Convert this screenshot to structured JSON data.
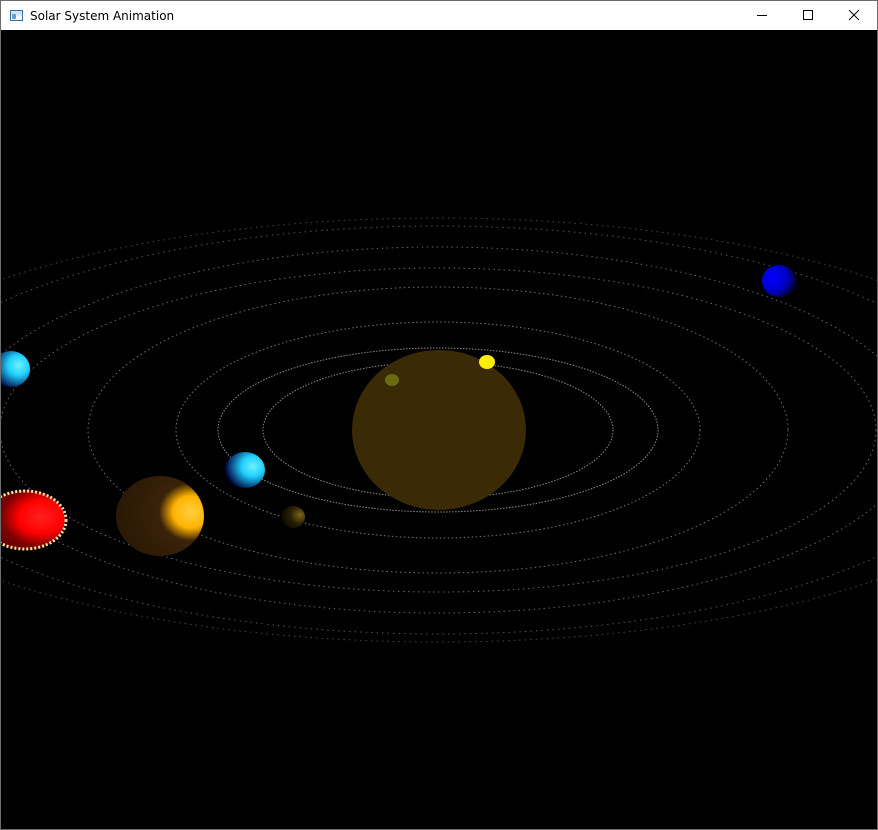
{
  "window": {
    "title": "Solar System Animation",
    "controls": [
      "minimize-icon",
      "maximize-icon",
      "close-icon"
    ]
  },
  "scene": {
    "background": "#000000",
    "orbit_color": "#8c8c8c",
    "bodies": [
      {
        "name": "sun",
        "color": "#3a2a05"
      },
      {
        "name": "planet-yellow",
        "color": "#ffee00"
      },
      {
        "name": "planet-olive",
        "color": "#6a6a10"
      },
      {
        "name": "planet-small-dark",
        "color": "#6b5a10"
      },
      {
        "name": "planet-cyan",
        "color": "#1fd0ff"
      },
      {
        "name": "planet-orange",
        "color": "#ffb300"
      },
      {
        "name": "planet-red",
        "color": "#ff0000"
      },
      {
        "name": "planet-cyan-left",
        "color": "#19c8f0"
      },
      {
        "name": "planet-blue",
        "color": "#0000c8"
      }
    ]
  }
}
